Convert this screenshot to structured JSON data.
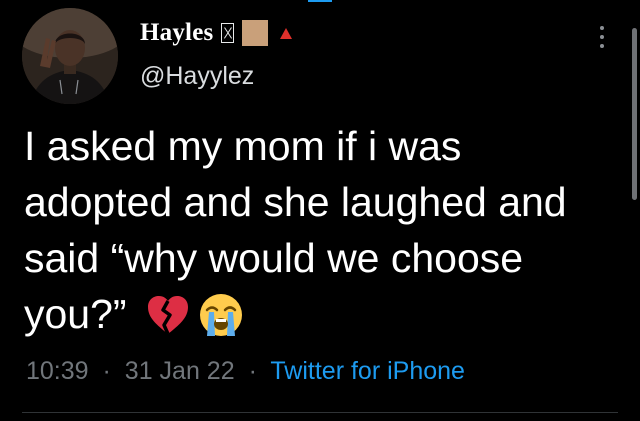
{
  "author": {
    "display_name": "Hayles",
    "handle": "@Hayylez"
  },
  "tweet": {
    "text_lines": [
      "I asked my mom if i was",
      "adopted and she laughed and",
      "said “why would we choose",
      "you?”"
    ],
    "emojis": [
      "broken-heart-icon",
      "loudly-crying-face-icon"
    ]
  },
  "meta": {
    "time": "10:39",
    "separator": "·",
    "date": "31 Jan 22",
    "source": "Twitter for iPhone"
  },
  "colors": {
    "background": "#000000",
    "text": "#ffffff",
    "secondary": "#71767b",
    "accent": "#1d9bf0",
    "swatch": "#c9a07a",
    "triangle": "#e0302b"
  }
}
